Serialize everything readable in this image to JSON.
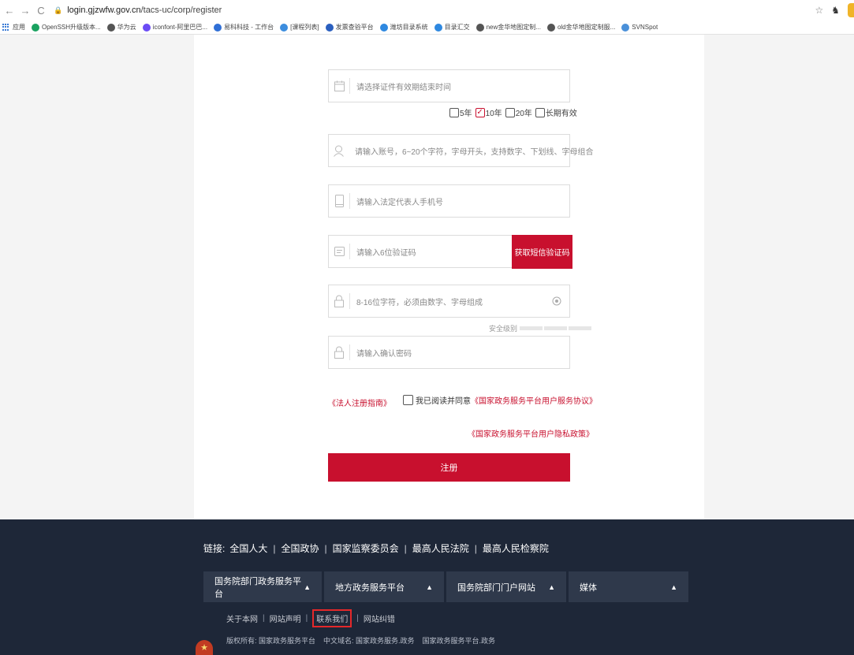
{
  "browser": {
    "url_host": "login.gjzwfw.gov.cn",
    "url_path": "/tacs-uc/corp/register",
    "bookmarks": [
      {
        "icon": "apps-icon",
        "label": "应用",
        "color": "#3a7bd5"
      },
      {
        "icon": "drive-icon",
        "label": "OpenSSH升级版本...",
        "color": "#1aa260"
      },
      {
        "icon": "globe-icon",
        "label": "华为云",
        "color": "#555555"
      },
      {
        "icon": "iconfont-icon",
        "label": "iconfont-阿里巴巴...",
        "color": "#6b4cf5"
      },
      {
        "icon": "wiki-icon",
        "label": "易科科技 - 工作台",
        "color": "#2f6fd6"
      },
      {
        "icon": "course-icon",
        "label": "[课程列表]",
        "color": "#3c8dde"
      },
      {
        "icon": "search-icon",
        "label": "发票查验平台",
        "color": "#2a5fbf"
      },
      {
        "icon": "app-icon",
        "label": "潍坊目录系统",
        "color": "#2e88e0"
      },
      {
        "icon": "app-icon",
        "label": "目录汇交",
        "color": "#2e88e0"
      },
      {
        "icon": "globe-icon",
        "label": "new金华地图定制...",
        "color": "#555555"
      },
      {
        "icon": "globe-icon",
        "label": "old金华地图定制服...",
        "color": "#555555"
      },
      {
        "icon": "svn-icon",
        "label": "SVNSpot",
        "color": "#4a90d9"
      }
    ]
  },
  "form": {
    "expiry_placeholder": "请选择证件有效期结束时间",
    "validity_options": [
      {
        "label": "5年",
        "checked": false
      },
      {
        "label": "10年",
        "checked": true
      },
      {
        "label": "20年",
        "checked": false
      },
      {
        "label": "长期有效",
        "checked": false
      }
    ],
    "account_placeholder": "请输入账号，6~20个字符，字母开头，支持数字、下划线、字母组合",
    "phone_placeholder": "请输入法定代表人手机号",
    "sms_placeholder": "请输入6位验证码",
    "sms_button": "获取短信验证码",
    "password_placeholder": "8-16位字符，必须由数字、字母组成",
    "strength_label": "安全级别",
    "confirm_placeholder": "请输入确认密码",
    "guide_link": "《法人注册指南》",
    "agree_text": "我已阅读并同意",
    "agreement_link": "《国家政务服务平台用户服务协议》",
    "privacy_link": "《国家政务服务平台用户隐私政策》",
    "register_button": "注册"
  },
  "footer": {
    "links_label": "链接:",
    "links": [
      "全国人大",
      "全国政协",
      "国家监察委员会",
      "最高人民法院",
      "最高人民检察院"
    ],
    "dropdowns": [
      {
        "label": "国务院部门政务服务平台",
        "w": 150
      },
      {
        "label": "地方政务服务平台",
        "w": 152
      },
      {
        "label": "国务院部门门户网站",
        "w": 152
      },
      {
        "label": "媒体",
        "w": 152
      }
    ],
    "about": [
      "关于本网",
      "网站声明",
      "联系我们",
      "网站纠错"
    ],
    "copyright": "版权所有: 国家政务服务平台",
    "domain_cn": "中文域名: 国家政务服务.政务",
    "domain_cn2": "国家政务服务平台.政务"
  }
}
